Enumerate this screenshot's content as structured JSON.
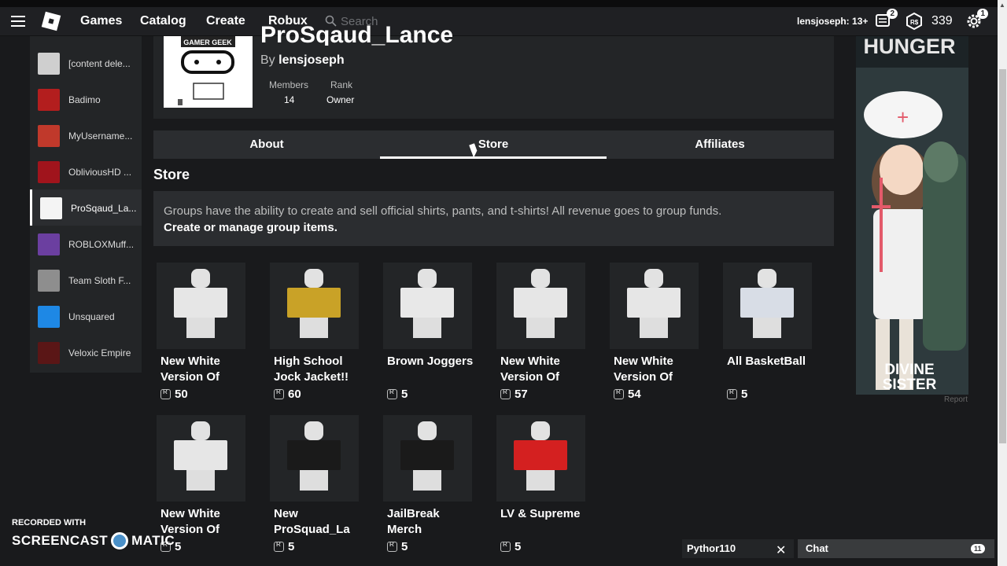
{
  "nav": {
    "links": [
      "Games",
      "Catalog",
      "Create",
      "Robux"
    ],
    "search_placeholder": "Search",
    "username": "lensjoseph: 13+",
    "notifications_count": "2",
    "robux": "339",
    "settings_count": "1"
  },
  "sidebar": {
    "groups": [
      {
        "name": "[content dele...",
        "color": "#cfcfcf"
      },
      {
        "name": "Badimo",
        "color": "#b31e1e"
      },
      {
        "name": "MyUsername...",
        "color": "#c0392b"
      },
      {
        "name": "ObliviousHD ...",
        "color": "#a0141c"
      },
      {
        "name": "ProSqaud_La...",
        "color": "#f4f4f4"
      },
      {
        "name": "ROBLOXMuff...",
        "color": "#6b3fa0"
      },
      {
        "name": "Team Sloth F...",
        "color": "#8e8e8e"
      },
      {
        "name": "Unsquared",
        "color": "#1e88e5"
      },
      {
        "name": "Veloxic Empire",
        "color": "#5a1616"
      }
    ]
  },
  "group": {
    "title": "ProSqaud_Lance",
    "by_label": "By",
    "owner": "lensjoseph",
    "members_label": "Members",
    "members_value": "14",
    "rank_label": "Rank",
    "rank_value": "Owner",
    "emblem_text": "GAMER GEEK"
  },
  "tabs": [
    "About",
    "Store",
    "Affiliates"
  ],
  "active_tab": "Store",
  "store": {
    "title": "Store",
    "info": "Groups have the ability to create and sell official shirts, pants, and t-shirts! All revenue goes to group funds.",
    "manage_link": "Create or manage group items.",
    "items": [
      {
        "name": "New White Version Of",
        "price": "50",
        "color": "#e6e6e6"
      },
      {
        "name": "High School Jock Jacket!!",
        "price": "60",
        "color": "#c9a227"
      },
      {
        "name": "Brown Joggers",
        "price": "5",
        "color": "#e8e8e8"
      },
      {
        "name": "New White Version Of",
        "price": "57",
        "color": "#e6e6e6"
      },
      {
        "name": "New White Version Of",
        "price": "54",
        "color": "#e6e6e6"
      },
      {
        "name": "All BasketBall",
        "price": "5",
        "color": "#d8dde6"
      },
      {
        "name": "New White Version Of",
        "price": "5",
        "color": "#e6e6e6"
      },
      {
        "name": "New ProSquad_La",
        "price": "5",
        "color": "#1a1a1a"
      },
      {
        "name": "JailBreak Merch",
        "price": "5",
        "color": "#1a1a1a"
      },
      {
        "name": "LV & Supreme",
        "price": "5",
        "color": "#d42020"
      }
    ]
  },
  "ad": {
    "top_text": "HUNGER",
    "bottom_text_1": "DIVINE",
    "bottom_text_2": "SISTER",
    "report": "Report"
  },
  "chat": {
    "user": "Pythor110",
    "label": "Chat",
    "count": "11"
  },
  "watermark": {
    "small": "RECORDED WITH",
    "big_left": "SCREENCAST",
    "big_right": "MATIC"
  }
}
